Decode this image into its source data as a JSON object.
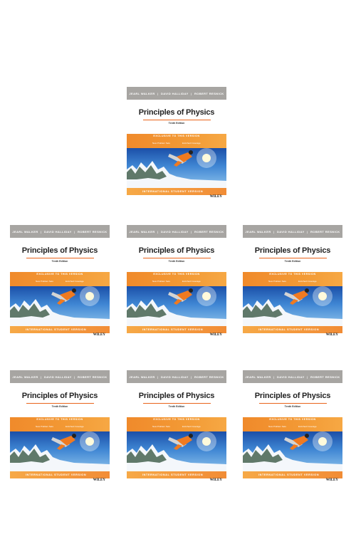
{
  "book": {
    "authors": [
      "JEARL WALKER",
      "DAVID HALLIDAY",
      "ROBERT RESNICK"
    ],
    "title": "Principles of Physics",
    "edition": "Tenth Edition",
    "exclusive": "EXCLUSIVE TO THIS VERSION",
    "feature1": "New Problem Sets",
    "feature2": "Enriched Coverage",
    "version": "INTERNATIONAL STUDENT VERSION",
    "publisher": "WILEY"
  },
  "colors": {
    "author_bar": "#a7a5a2",
    "orange": "#f08a2b",
    "title_text": "#222222"
  }
}
